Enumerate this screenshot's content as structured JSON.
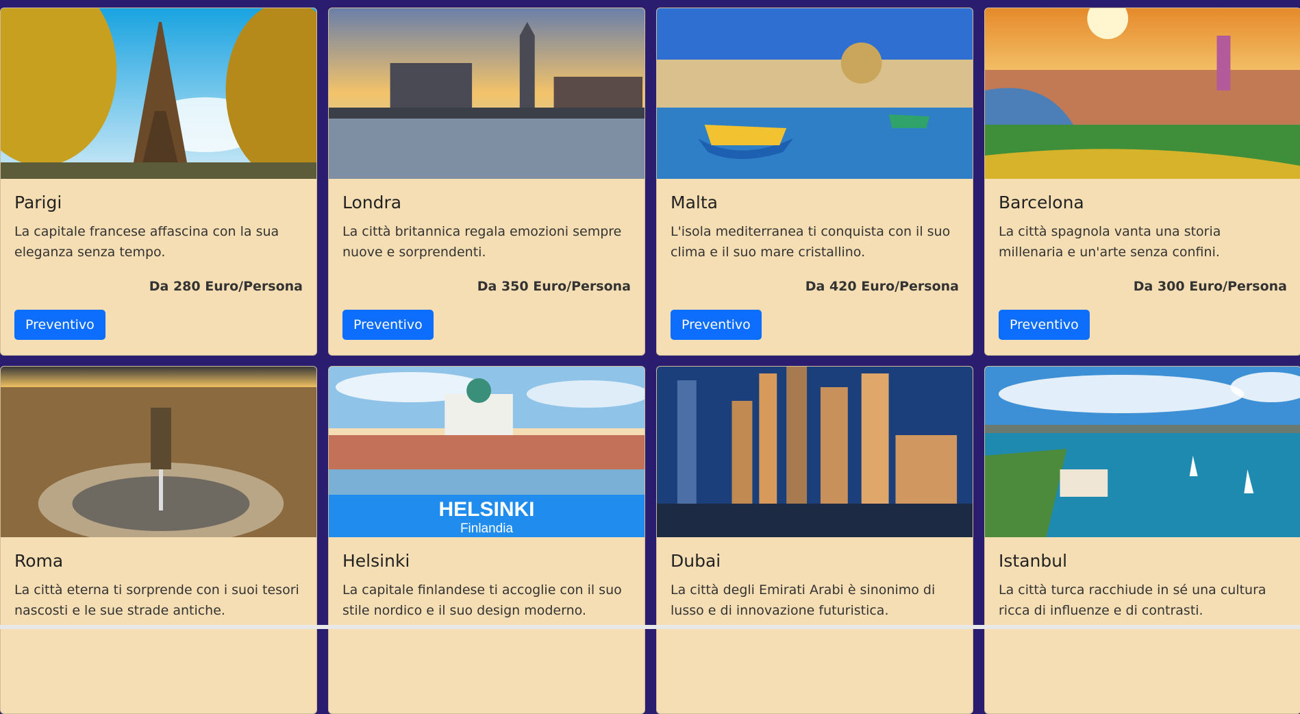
{
  "cards": [
    {
      "title": "Parigi",
      "desc": "La capitale francese affascina con la sua eleganza senza tempo.",
      "price": "Da 280 Euro/Persona",
      "button": "Preventivo"
    },
    {
      "title": "Londra",
      "desc": "La città britannica regala emozioni sempre nuove e sorprendenti.",
      "price": "Da 350 Euro/Persona",
      "button": "Preventivo"
    },
    {
      "title": "Malta",
      "desc": "L'isola mediterranea ti conquista con il suo clima e il suo mare cristallino.",
      "price": "Da 420 Euro/Persona",
      "button": "Preventivo"
    },
    {
      "title": "Barcelona",
      "desc": "La città spagnola vanta una storia millenaria e un'arte senza confini.",
      "price": "Da 300 Euro/Persona",
      "button": "Preventivo"
    },
    {
      "title": "Roma",
      "desc": "La città eterna ti sorprende con i suoi tesori nascosti e le sue strade antiche."
    },
    {
      "title": "Helsinki",
      "desc": "La capitale finlandese ti accoglie con il suo stile nordico e il suo design moderno.",
      "image_caption": "HELSINKI",
      "image_subcaption": "Finlandia"
    },
    {
      "title": "Dubai",
      "desc": "La città degli Emirati Arabi è sinonimo di lusso e di innovazione futuristica."
    },
    {
      "title": "Istanbul",
      "desc": "La città turca racchiude in sé una cultura ricca di influenze e di contrasti."
    }
  ],
  "colors": {
    "page_bg": "#2a1c6e",
    "card_bg": "#f5deb3",
    "button_bg": "#0d6efd"
  }
}
